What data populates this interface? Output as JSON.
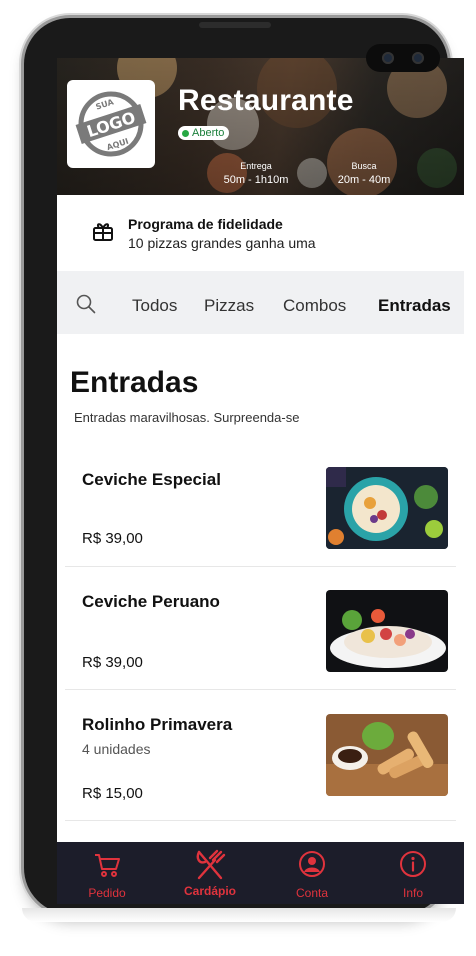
{
  "restaurant": {
    "name": "Restaurante",
    "status": "Aberto",
    "logo_text": {
      "top": "SUA",
      "middle": "LOGO",
      "bottom": "AQUI"
    },
    "delivery_label": "Entrega",
    "delivery_time": "50m - 1h10m",
    "pickup_label": "Busca",
    "pickup_time": "20m - 40m"
  },
  "loyalty": {
    "icon": "gift-icon",
    "title": "Programa de fidelidade",
    "description": "10 pizzas grandes ganha uma"
  },
  "tabs": {
    "search_icon": "search-icon",
    "items": [
      {
        "label": "Todos",
        "active": false
      },
      {
        "label": "Pizzas",
        "active": false
      },
      {
        "label": "Combos",
        "active": false
      },
      {
        "label": "Entradas",
        "active": true
      }
    ]
  },
  "section": {
    "title": "Entradas",
    "description": "Entradas maravilhosas. Surpreenda-se"
  },
  "products": [
    {
      "name": "Ceviche Especial",
      "subtitle": "",
      "price": "R$ 39,00"
    },
    {
      "name": "Ceviche Peruano",
      "subtitle": "",
      "price": "R$ 39,00"
    },
    {
      "name": "Rolinho Primavera",
      "subtitle": "4 unidades",
      "price": "R$ 15,00"
    }
  ],
  "bottom_nav": [
    {
      "label": "Pedido",
      "icon": "cart-icon",
      "active": false
    },
    {
      "label": "Cardápio",
      "icon": "fork-knife-icon",
      "active": true
    },
    {
      "label": "Conta",
      "icon": "user-circle-icon",
      "active": false
    },
    {
      "label": "Info",
      "icon": "info-icon",
      "active": false
    }
  ],
  "colors": {
    "accent": "#e0333d",
    "nav_bg": "#1c1d2a",
    "status_green": "#27a844"
  }
}
